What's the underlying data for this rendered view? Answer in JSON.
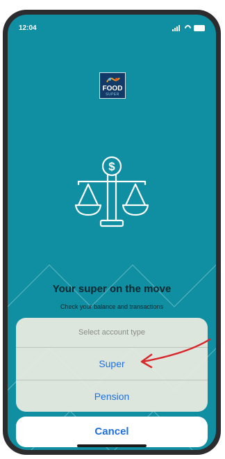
{
  "status_bar": {
    "time": "12:04"
  },
  "logo": {
    "name": "FOOD",
    "sub": "SUPER"
  },
  "welcome": {
    "headline": "Your super on the move",
    "subline": "Check your balance and transactions"
  },
  "action_sheet": {
    "title": "Select account type",
    "options": [
      {
        "label": "Super"
      },
      {
        "label": "Pension"
      }
    ],
    "cancel_label": "Cancel"
  },
  "colors": {
    "background": "#0f8fa1",
    "sheet": "#eeeee2",
    "action_blue": "#1f6fe0",
    "annotation_red": "#d9262a"
  },
  "icons": [
    "balance-scale-icon",
    "dollar-sign-icon",
    "signal-icon",
    "wifi-icon",
    "battery-icon"
  ]
}
